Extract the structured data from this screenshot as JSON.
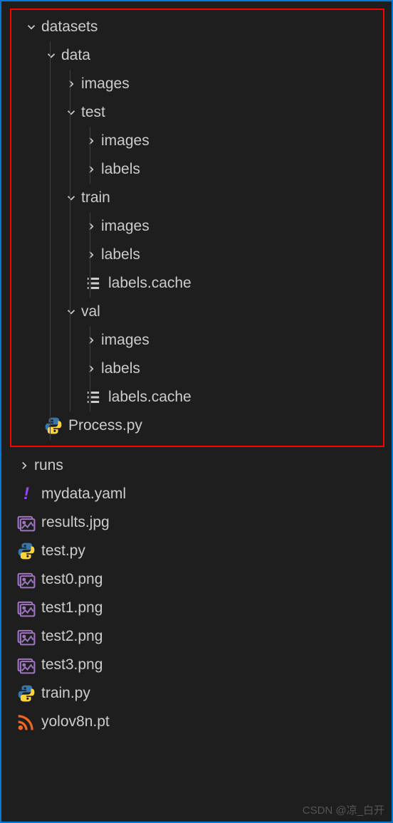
{
  "tree": {
    "datasets": "datasets",
    "data": "data",
    "images": "images",
    "test": "test",
    "labels": "labels",
    "train": "train",
    "labels_cache": "labels.cache",
    "val": "val",
    "process_py": "Process.py",
    "runs": "runs",
    "mydata_yaml": "mydata.yaml",
    "results_jpg": "results.jpg",
    "test_py": "test.py",
    "test0_png": "test0.png",
    "test1_png": "test1.png",
    "test2_png": "test2.png",
    "test3_png": "test3.png",
    "train_py": "train.py",
    "yolov8n_pt": "yolov8n.pt"
  },
  "watermark": "CSDN @凉_白开"
}
